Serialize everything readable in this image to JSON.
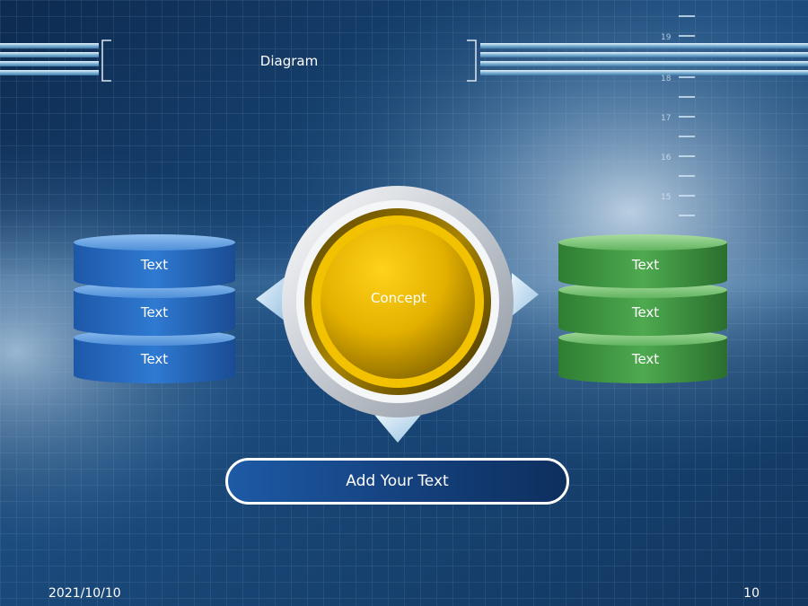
{
  "slide": {
    "title": "Diagram",
    "center": {
      "label": "Concept"
    },
    "left_stack": {
      "items": [
        "Text",
        "Text",
        "Text"
      ],
      "color": "#2a6bc4"
    },
    "right_stack": {
      "items": [
        "Text",
        "Text",
        "Text"
      ],
      "color": "#3f9a43"
    },
    "bottom_button": {
      "label": "Add Your Text"
    },
    "ruler_marks": [
      "19",
      "18",
      "17",
      "16",
      "15"
    ],
    "footer": {
      "date": "2021/10/10",
      "page": "10"
    },
    "colors": {
      "background": "#123a66",
      "accent_yellow": "#f2c200",
      "silver": "#c8cdd4"
    }
  }
}
